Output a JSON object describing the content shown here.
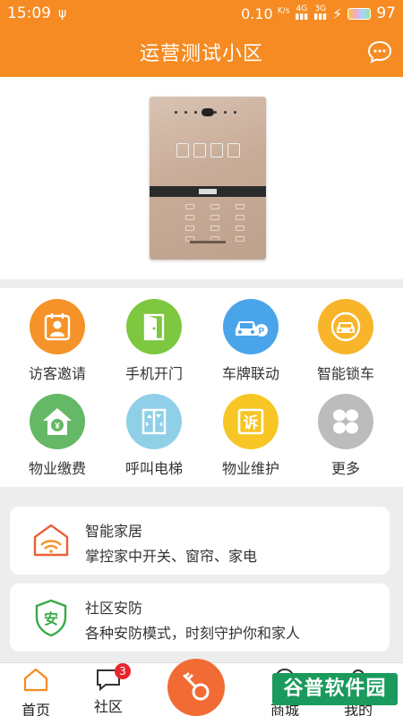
{
  "status_bar": {
    "time": "15:09",
    "usb_glyph": "ψ",
    "speed": "0.10",
    "speed_unit": "K/s",
    "sig1_top": "4G",
    "sig2_top": "3G",
    "battery": "97"
  },
  "header": {
    "title": "运营测试小区"
  },
  "grid": [
    {
      "label": "访客邀请",
      "icon": "visitor-icon",
      "color": "#f5932a"
    },
    {
      "label": "手机开门",
      "icon": "door-icon",
      "color": "#7dc741"
    },
    {
      "label": "车牌联动",
      "icon": "car-parking-icon",
      "color": "#4aa4ea"
    },
    {
      "label": "智能锁车",
      "icon": "car-lock-icon",
      "color": "#f8b52a"
    },
    {
      "label": "物业缴费",
      "icon": "payment-icon",
      "color": "#65b865"
    },
    {
      "label": "呼叫电梯",
      "icon": "elevator-icon",
      "color": "#8fd0e8"
    },
    {
      "label": "物业维护",
      "icon": "complaint-icon",
      "color": "#f7c625"
    },
    {
      "label": "更多",
      "icon": "more-icon",
      "color": "#bcbcbc"
    }
  ],
  "cards": [
    {
      "title": "智能家居",
      "desc": "掌控家中开关、窗帘、家电",
      "icon": "smart-home-icon"
    },
    {
      "title": "社区安防",
      "desc": "各种安防模式，时刻守护你和家人",
      "icon": "security-shield-icon",
      "shield_char": "安"
    }
  ],
  "nav": {
    "home": "首页",
    "community": "社区",
    "community_badge": "3",
    "mall": "商城",
    "mine": "我的"
  },
  "watermark": "谷普软件园",
  "colors": {
    "primary": "#f58b22",
    "key_button": "#f26b35"
  }
}
